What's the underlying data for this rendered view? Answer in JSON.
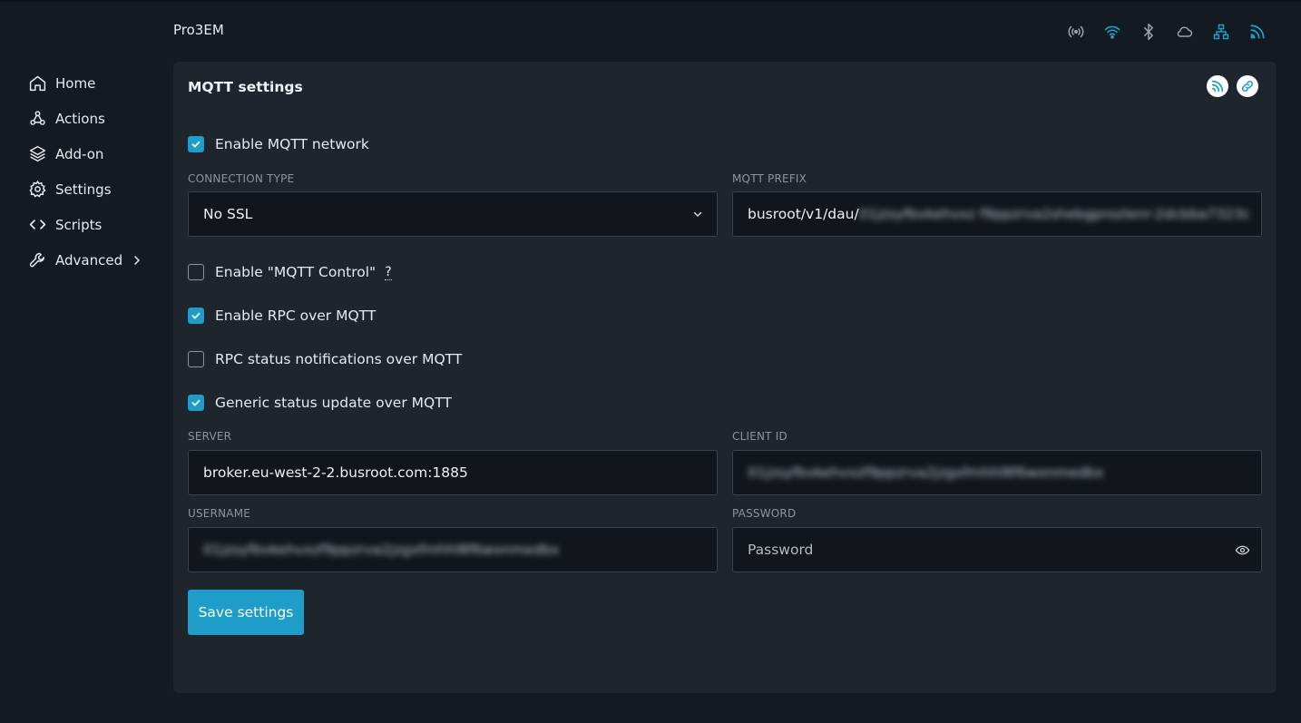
{
  "header": {
    "device_name": "Pro3EM",
    "status_icons": [
      {
        "name": "radio-broadcast-icon",
        "color": "#9aa3ab"
      },
      {
        "name": "wifi-icon",
        "color": "#1e9dc9"
      },
      {
        "name": "bluetooth-icon",
        "color": "#9aa3ab"
      },
      {
        "name": "cloud-icon",
        "color": "#9aa3ab"
      },
      {
        "name": "ethernet-network-icon",
        "color": "#1e9dc9"
      },
      {
        "name": "mqtt-feed-icon",
        "color": "#1e9dc9"
      }
    ]
  },
  "sidebar": {
    "items": [
      {
        "label": "Home",
        "icon": "home-icon"
      },
      {
        "label": "Actions",
        "icon": "webhook-icon"
      },
      {
        "label": "Add-on",
        "icon": "layers-icon"
      },
      {
        "label": "Settings",
        "icon": "gear-icon"
      },
      {
        "label": "Scripts",
        "icon": "code-icon"
      },
      {
        "label": "Advanced",
        "icon": "wrench-icon"
      }
    ]
  },
  "card": {
    "title": "MQTT settings",
    "header_buttons": [
      "mqtt-feed-icon",
      "link-icon"
    ]
  },
  "form": {
    "enable_mqtt": {
      "label": "Enable MQTT network",
      "checked": true
    },
    "connection_type": {
      "label": "CONNECTION TYPE",
      "value": "No SSL"
    },
    "mqtt_prefix": {
      "label": "MQTT PREFIX",
      "value_visible": "busroot/v1/dau/",
      "value_blurred": "01jzsyfbvkehvxz f9ppzrva2shebgprozlenr-2dcbba7323c"
    },
    "enable_mqtt_control": {
      "label": "Enable \"MQTT Control\"",
      "help": "?",
      "checked": false
    },
    "enable_rpc": {
      "label": "Enable RPC over MQTT",
      "checked": true
    },
    "rpc_status": {
      "label": "RPC status notifications over MQTT",
      "checked": false
    },
    "generic_status": {
      "label": "Generic status update over MQTT",
      "checked": true
    },
    "server": {
      "label": "SERVER",
      "value": "broker.eu-west-2-2.busroot.com:1885"
    },
    "client_id": {
      "label": "CLIENT ID",
      "value_blurred": "01jzsyfbvkehvxzf9ppzrva2jzgxfmhhl8f6wxnmedbx"
    },
    "username": {
      "label": "USERNAME",
      "value_blurred": "01jzsyfbvkehvxzf9ppzrva2jzgxfmhhl8f6wxnmedbx"
    },
    "password": {
      "label": "PASSWORD",
      "placeholder": "Password"
    },
    "save_label": "Save settings"
  },
  "colors": {
    "accent": "#1e9dc9",
    "background": "#141a21",
    "card": "#1e252d"
  }
}
